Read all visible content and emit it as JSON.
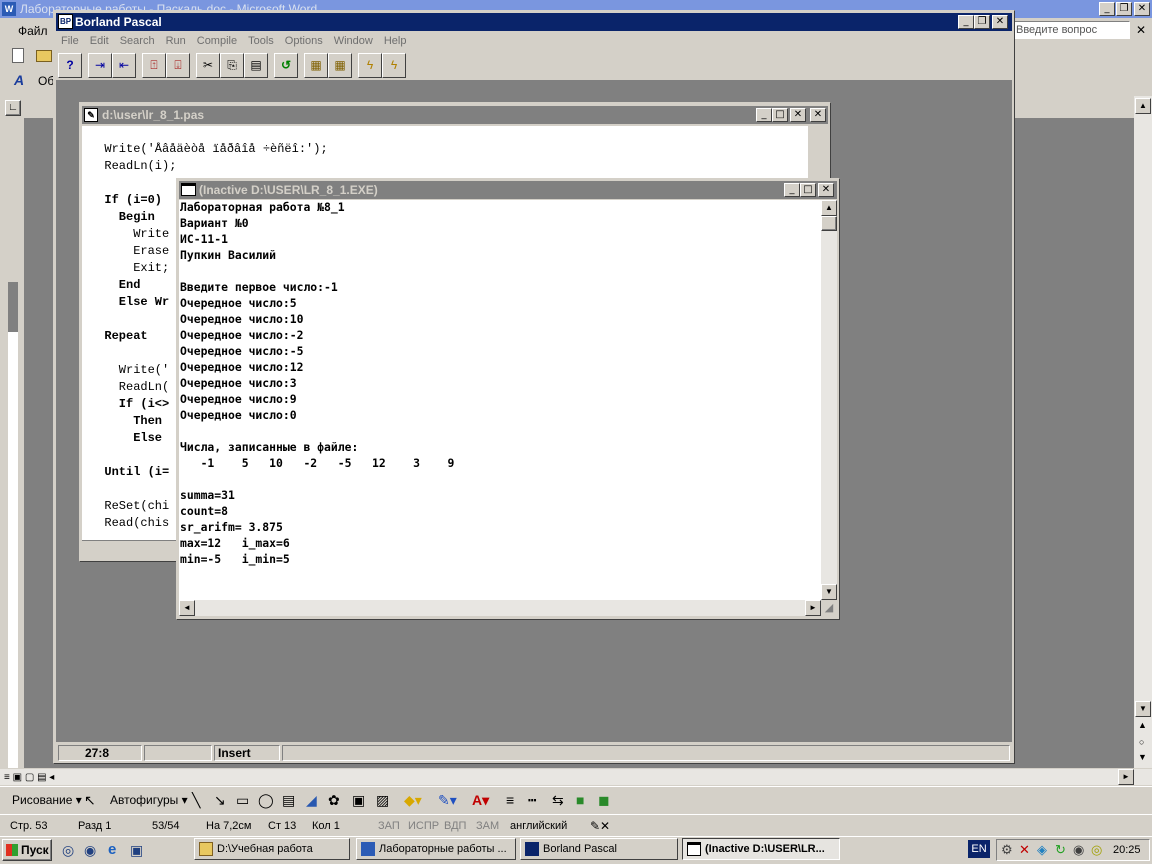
{
  "word": {
    "title": "Лабораторные работы - Паскаль.doc - Microsoft Word",
    "menu_first": "Файл",
    "help_placeholder": "Введите вопрос",
    "style_box": "Об",
    "drawing_toolbar": {
      "drawing": "Рисование ▾",
      "autoshapes": "Автофигуры ▾"
    },
    "status": {
      "page": "Стр. 53",
      "section": "Разд 1",
      "pages": "53/54",
      "at": "На 7,2см",
      "line": "Ст 13",
      "col": "Кол 1",
      "rec": "ЗАП",
      "trk": "ИСПР",
      "ext": "ВДП",
      "ovr": "ЗАМ",
      "lang": "английский"
    }
  },
  "bp": {
    "title": "Borland Pascal",
    "menu": [
      "File",
      "Edit",
      "Search",
      "Run",
      "Compile",
      "Tools",
      "Options",
      "Window",
      "Help"
    ],
    "status_pos": "27:8",
    "status_mode": "Insert"
  },
  "editor": {
    "title": "d:\\user\\lr_8_1.pas",
    "lines": [
      "  Write('Åâåäèòå ïåðâîå ÷èñëî:');",
      "  ReadLn(i);",
      "",
      "  If (i=0)",
      "    Begin",
      "      Write",
      "      Erase",
      "      Exit;",
      "    End",
      "    Else Wr",
      "",
      "  Repeat",
      "",
      "    Write('",
      "    ReadLn(",
      "    If (i<>",
      "      Then",
      "      Else",
      "",
      "  Until (i=",
      "",
      "  ReSet(chi",
      "  Read(chis"
    ]
  },
  "console": {
    "title": "(Inactive D:\\USER\\LR_8_1.EXE)",
    "lines": [
      "Лабораторная работа №8_1",
      "Вариант №0",
      "ИС-11-1",
      "Пупкин Василий",
      "",
      "Введите первое число:-1",
      "Очередное число:5",
      "Очередное число:10",
      "Очередное число:-2",
      "Очередное число:-5",
      "Очередное число:12",
      "Очередное число:3",
      "Очередное число:9",
      "Очередное число:0",
      "",
      "Числа, записанные в файле:",
      "   -1    5   10   -2   -5   12    3    9",
      "",
      "summa=31",
      "count=8",
      "sr_arifm= 3.875",
      "max=12   i_max=6",
      "min=-5   i_min=5"
    ]
  },
  "taskbar": {
    "start": "Пуск",
    "tasks": [
      "D:\\Учебная работа",
      "Лабораторные работы ...",
      "Borland Pascal",
      "(Inactive D:\\USER\\LR..."
    ],
    "lang": "EN",
    "clock": "20:25"
  },
  "colors": {
    "title_active": "#0a246a",
    "title_inactive": "#808080",
    "desktop_gray": "#808080",
    "console_bg": "#ffffff"
  }
}
